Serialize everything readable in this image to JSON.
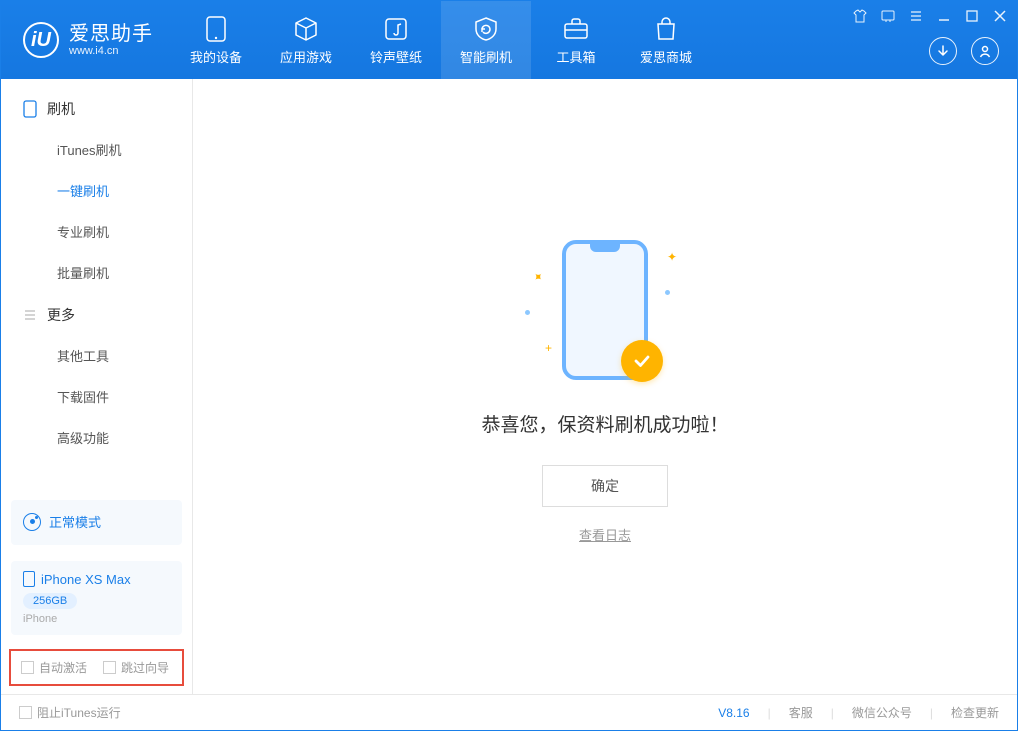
{
  "app": {
    "name": "爱思助手",
    "url": "www.i4.cn"
  },
  "nav": {
    "tabs": [
      {
        "label": "我的设备"
      },
      {
        "label": "应用游戏"
      },
      {
        "label": "铃声壁纸"
      },
      {
        "label": "智能刷机"
      },
      {
        "label": "工具箱"
      },
      {
        "label": "爱思商城"
      }
    ],
    "active_index": 3
  },
  "sidebar": {
    "groups": [
      {
        "title": "刷机",
        "items": [
          {
            "label": "iTunes刷机"
          },
          {
            "label": "一键刷机",
            "active": true
          },
          {
            "label": "专业刷机"
          },
          {
            "label": "批量刷机"
          }
        ]
      },
      {
        "title": "更多",
        "items": [
          {
            "label": "其他工具"
          },
          {
            "label": "下载固件"
          },
          {
            "label": "高级功能"
          }
        ]
      }
    ]
  },
  "device": {
    "mode": "正常模式",
    "name": "iPhone XS Max",
    "capacity": "256GB",
    "type": "iPhone"
  },
  "options": {
    "auto_activate": "自动激活",
    "skip_guide": "跳过向导"
  },
  "result": {
    "message": "恭喜您，保资料刷机成功啦！",
    "ok": "确定",
    "view_log": "查看日志"
  },
  "status": {
    "block_itunes": "阻止iTunes运行",
    "version": "V8.16",
    "links": [
      "客服",
      "微信公众号",
      "检查更新"
    ]
  },
  "colors": {
    "primary": "#1a7fe8",
    "accent": "#ffb400",
    "highlight_border": "#e74c3c"
  }
}
